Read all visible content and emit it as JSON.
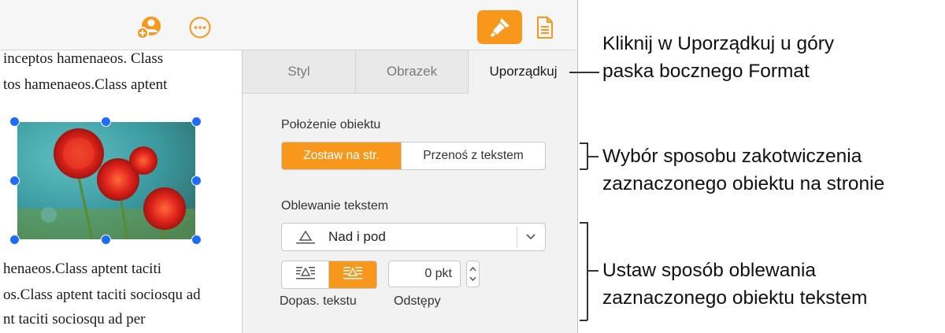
{
  "document": {
    "lines_top": [
      "inceptos hamenaeos. Class",
      "tos hamenaeos.Class aptent"
    ],
    "lines_bottom": [
      "henaeos.Class aptent taciti",
      "os.Class aptent taciti sociosqu ad",
      "nt taciti sociosqu ad per"
    ]
  },
  "toolbar": {
    "icons": [
      "add-collaborator-icon",
      "more-icon",
      "format-brush-icon",
      "document-icon"
    ],
    "accent": "#f7981d"
  },
  "sidebar": {
    "tabs": [
      {
        "label": "Styl"
      },
      {
        "label": "Obrazek"
      },
      {
        "label": "Uporządkuj"
      }
    ],
    "object_placement": {
      "heading": "Położenie obiektu",
      "options": [
        "Zostaw na str.",
        "Przenoś z tekstem"
      ],
      "selected": "Zostaw na str."
    },
    "text_wrap": {
      "heading": "Oblewanie tekstem",
      "selected": "Nad i pod",
      "fit_label": "Dopas. tekstu",
      "spacing_label": "Odstępy",
      "spacing_value": "0 pkt"
    }
  },
  "callouts": {
    "c1": [
      "Kliknij w Uporządkuj u góry",
      "paska bocznego Format"
    ],
    "c2": [
      "Wybór sposobu zakotwiczenia",
      "zaznaczonego obiektu na stronie"
    ],
    "c3": [
      "Ustaw sposób oblewania",
      "zaznaczonego obiektu tekstem"
    ]
  }
}
